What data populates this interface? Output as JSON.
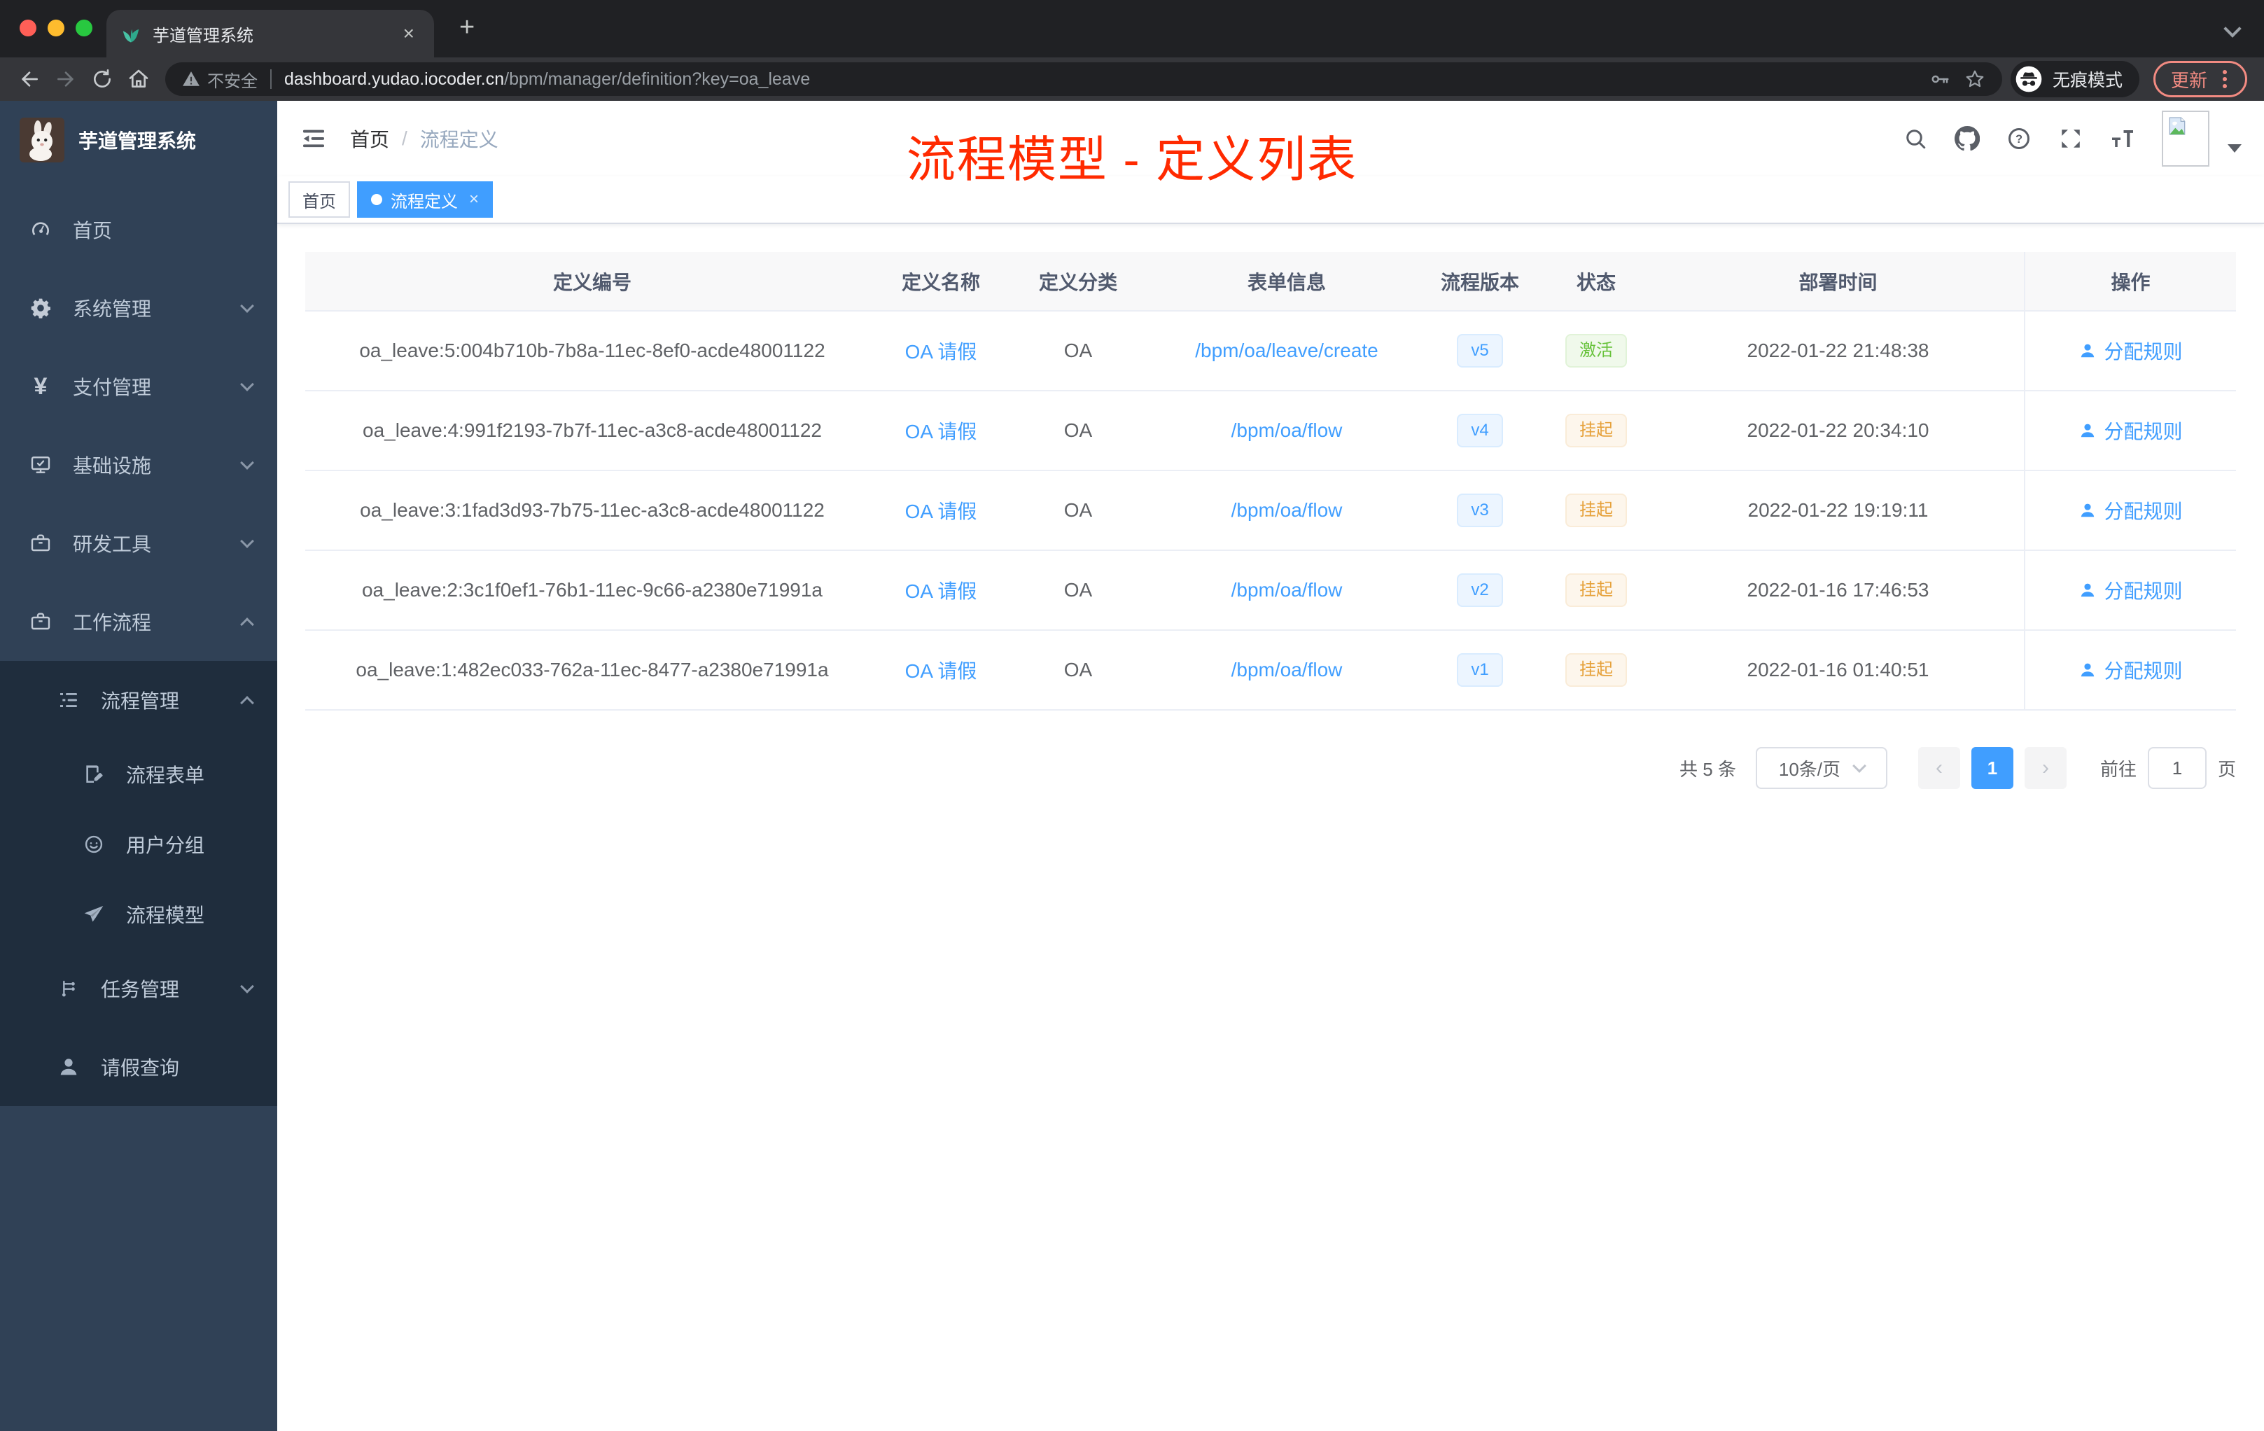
{
  "browser": {
    "tab_title": "芋道管理系统",
    "security_label": "不安全",
    "url_domain": "dashboard.yudao.iocoder.cn",
    "url_path": "/bpm/manager/definition?key=oa_leave",
    "incognito_label": "无痕模式",
    "update_label": "更新"
  },
  "glyphs": {
    "close": "×",
    "plus": "+"
  },
  "sidebar": {
    "app_title": "芋道管理系统",
    "items": [
      {
        "label": "首页",
        "icon": "gauge-icon"
      },
      {
        "label": "系统管理",
        "icon": "gear-icon"
      },
      {
        "label": "支付管理",
        "icon": "yen-icon"
      },
      {
        "label": "基础设施",
        "icon": "monitor-icon"
      },
      {
        "label": "研发工具",
        "icon": "toolbox-icon"
      },
      {
        "label": "工作流程",
        "icon": "toolbox-icon"
      },
      {
        "label": "流程管理",
        "icon": "list-tree-icon"
      },
      {
        "label": "流程表单",
        "icon": "form-icon"
      },
      {
        "label": "用户分组",
        "icon": "user-group-icon"
      },
      {
        "label": "流程模型",
        "icon": "send-icon"
      },
      {
        "label": "任务管理",
        "icon": "tree-icon"
      },
      {
        "label": "请假查询",
        "icon": "user-icon"
      }
    ]
  },
  "header": {
    "breadcrumb_home": "首页",
    "breadcrumb_sep": "/",
    "breadcrumb_current": "流程定义",
    "annotation": "流程模型 - 定义列表",
    "annotation_color": "#ff2a00"
  },
  "tags": {
    "home": "首页",
    "active": "流程定义"
  },
  "table": {
    "columns": {
      "id": "定义编号",
      "name": "定义名称",
      "category": "定义分类",
      "form": "表单信息",
      "version": "流程版本",
      "status": "状态",
      "deployed": "部署时间",
      "actions": "操作"
    },
    "rows": [
      {
        "id": "oa_leave:5:004b710b-7b8a-11ec-8ef0-acde48001122",
        "name": "OA 请假",
        "category": "OA",
        "form": "/bpm/oa/leave/create",
        "version": "v5",
        "status": "激活",
        "status_type": "success",
        "deployed": "2022-01-22 21:48:38",
        "action": "分配规则"
      },
      {
        "id": "oa_leave:4:991f2193-7b7f-11ec-a3c8-acde48001122",
        "name": "OA 请假",
        "category": "OA",
        "form": "/bpm/oa/flow",
        "version": "v4",
        "status": "挂起",
        "status_type": "warning",
        "deployed": "2022-01-22 20:34:10",
        "action": "分配规则"
      },
      {
        "id": "oa_leave:3:1fad3d93-7b75-11ec-a3c8-acde48001122",
        "name": "OA 请假",
        "category": "OA",
        "form": "/bpm/oa/flow",
        "version": "v3",
        "status": "挂起",
        "status_type": "warning",
        "deployed": "2022-01-22 19:19:11",
        "action": "分配规则"
      },
      {
        "id": "oa_leave:2:3c1f0ef1-76b1-11ec-9c66-a2380e71991a",
        "name": "OA 请假",
        "category": "OA",
        "form": "/bpm/oa/flow",
        "version": "v2",
        "status": "挂起",
        "status_type": "warning",
        "deployed": "2022-01-16 17:46:53",
        "action": "分配规则"
      },
      {
        "id": "oa_leave:1:482ec033-762a-11ec-8477-a2380e71991a",
        "name": "OA 请假",
        "category": "OA",
        "form": "/bpm/oa/flow",
        "version": "v1",
        "status": "挂起",
        "status_type": "warning",
        "deployed": "2022-01-16 01:40:51",
        "action": "分配规则"
      }
    ]
  },
  "pagination": {
    "total": "共 5 条",
    "page_size": "10条/页",
    "prev": "‹",
    "current": "1",
    "next": "›",
    "goto_label": "前往",
    "goto_value": "1",
    "unit_label": "页"
  },
  "colors": {
    "accent": "#409eff",
    "success": "#67c23a",
    "warning": "#e6a23c",
    "sidebar": "#304156",
    "submenu": "#1f2d3d"
  }
}
